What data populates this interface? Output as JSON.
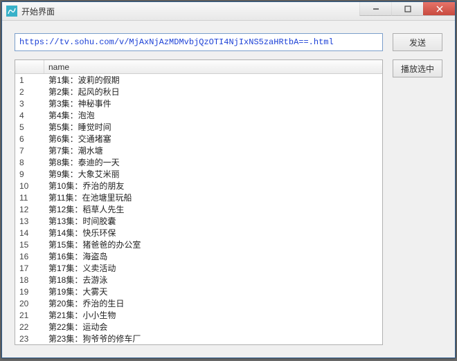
{
  "window": {
    "title": "开始界面"
  },
  "url_input": {
    "value": "https://tv.sohu.com/v/MjAxNjAzMDMvbjQzOTI4NjIxNS5zaHRtbA==.html"
  },
  "buttons": {
    "send": "发送",
    "play_selected": "播放选中"
  },
  "list": {
    "columns": {
      "index": "",
      "name": "name"
    },
    "items": [
      {
        "n": 1,
        "name": "第1集：波莉的假期"
      },
      {
        "n": 2,
        "name": "第2集：起风的秋日"
      },
      {
        "n": 3,
        "name": "第3集：神秘事件"
      },
      {
        "n": 4,
        "name": "第4集：泡泡"
      },
      {
        "n": 5,
        "name": "第5集：睡觉时间"
      },
      {
        "n": 6,
        "name": "第6集：交通堵塞"
      },
      {
        "n": 7,
        "name": "第7集：潮水塘"
      },
      {
        "n": 8,
        "name": "第8集：泰迪的一天"
      },
      {
        "n": 9,
        "name": "第9集：大象艾米丽"
      },
      {
        "n": 10,
        "name": "第10集：乔治的朋友"
      },
      {
        "n": 11,
        "name": "第11集：在池塘里玩船"
      },
      {
        "n": 12,
        "name": "第12集：稻草人先生"
      },
      {
        "n": 13,
        "name": "第13集：时间胶囊"
      },
      {
        "n": 14,
        "name": "第14集：快乐环保"
      },
      {
        "n": 15,
        "name": "第15集：猪爸爸的办公室"
      },
      {
        "n": 16,
        "name": "第16集：海盗岛"
      },
      {
        "n": 17,
        "name": "第17集：义卖活动"
      },
      {
        "n": 18,
        "name": "第18集：去游泳"
      },
      {
        "n": 19,
        "name": "第19集：大雾天"
      },
      {
        "n": 20,
        "name": "第20集：乔治的生日"
      },
      {
        "n": 21,
        "name": "第21集：小小生物"
      },
      {
        "n": 22,
        "name": "第22集：运动会"
      },
      {
        "n": 23,
        "name": "第23集：狗爷爷的修车厂"
      }
    ]
  }
}
